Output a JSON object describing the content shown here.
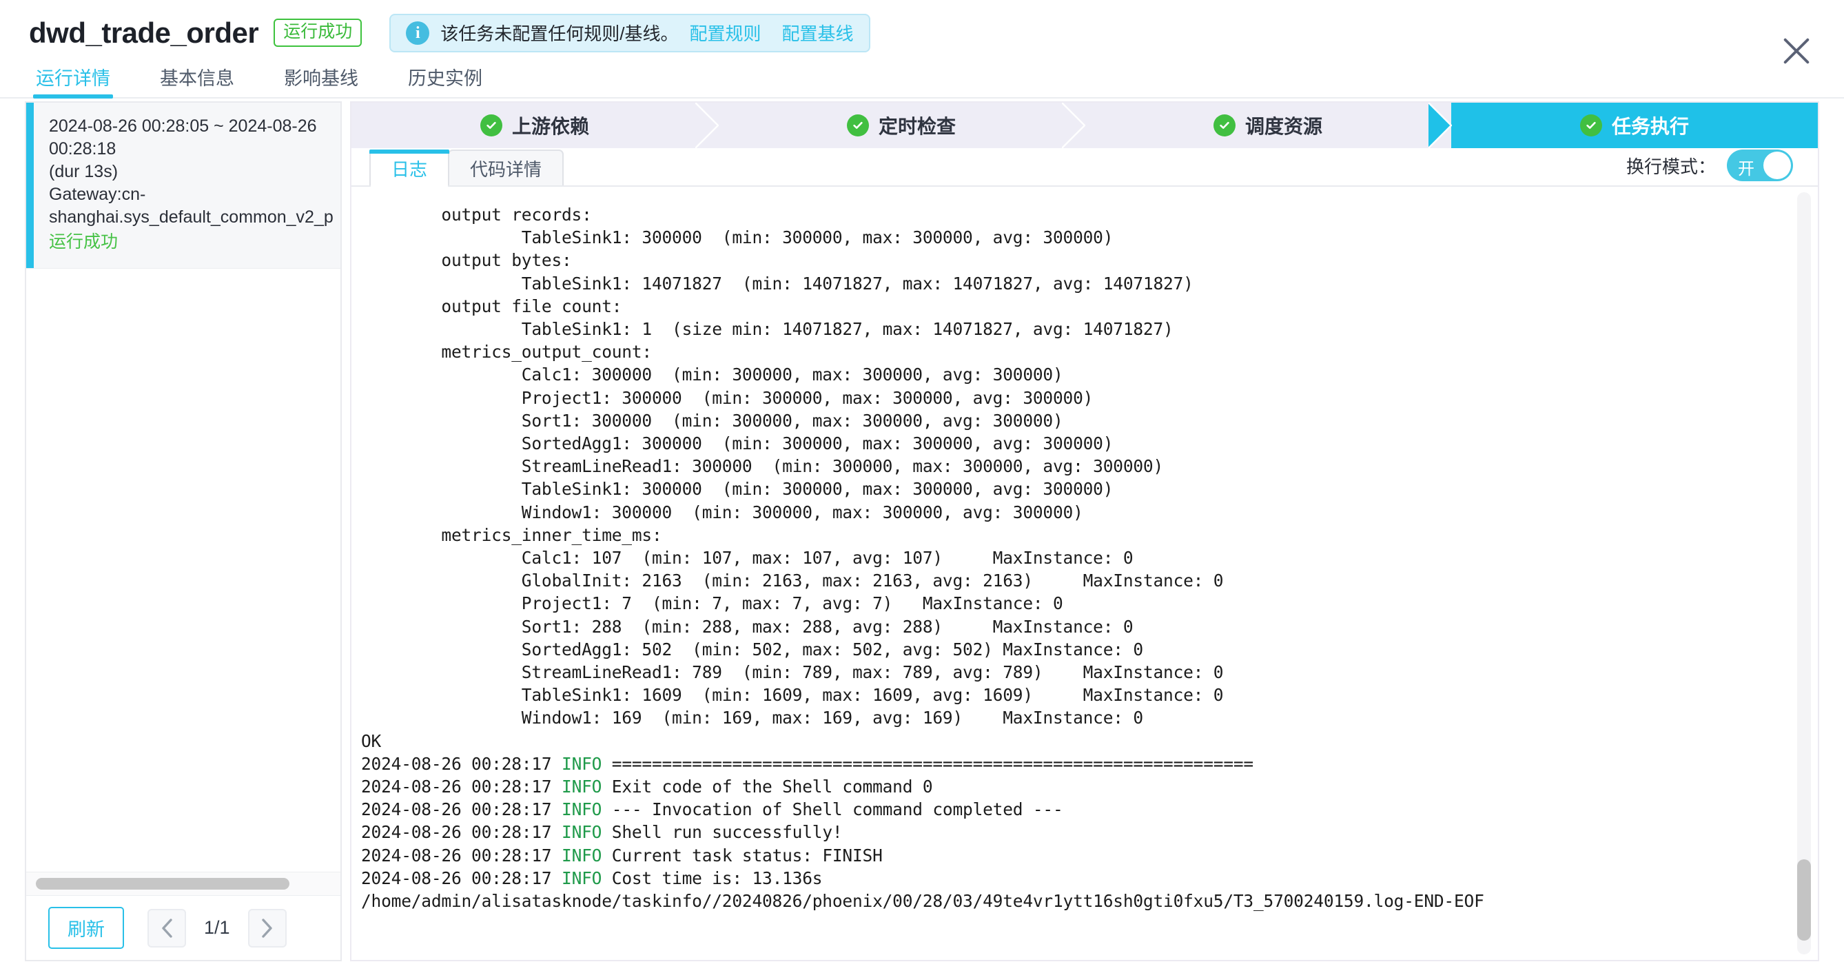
{
  "header": {
    "title": "dwd_trade_order",
    "status_badge": "运行成功",
    "notice": {
      "icon": "info-icon",
      "text": "该任务未配置任何规则/基线。",
      "links": [
        "配置规则",
        "配置基线"
      ]
    },
    "close_icon": "close-icon"
  },
  "tabs": [
    {
      "label": "运行详情",
      "active": true
    },
    {
      "label": "基本信息",
      "active": false
    },
    {
      "label": "影响基线",
      "active": false
    },
    {
      "label": "历史实例",
      "active": false
    }
  ],
  "left_panel": {
    "instance": {
      "time_range": "2024-08-26 00:28:05 ~ 2024-08-26 00:28:18",
      "duration": "(dur 13s)",
      "gateway": "Gateway:cn-shanghai.sys_default_common_v2_p",
      "status": "运行成功"
    },
    "footer": {
      "refresh_label": "刷新",
      "prev_icon": "chevron-left-icon",
      "next_icon": "chevron-right-icon",
      "page_label": "1/1"
    }
  },
  "steps": [
    {
      "label": "上游依赖",
      "state": "done",
      "icon": "check-circle-icon"
    },
    {
      "label": "定时检查",
      "state": "done",
      "icon": "check-circle-icon"
    },
    {
      "label": "调度资源",
      "state": "done",
      "icon": "check-circle-icon"
    },
    {
      "label": "任务执行",
      "state": "current",
      "icon": "check-circle-icon"
    }
  ],
  "log_panel": {
    "tabs": [
      {
        "label": "日志",
        "active": true
      },
      {
        "label": "代码详情",
        "active": false
      }
    ],
    "wrap_mode_label": "换行模式：",
    "wrap_mode_value": "开",
    "wrap_mode_on": true,
    "log_lines": [
      "        output records:",
      "                TableSink1: 300000  (min: 300000, max: 300000, avg: 300000)",
      "        output bytes:",
      "                TableSink1: 14071827  (min: 14071827, max: 14071827, avg: 14071827)",
      "        output file count:",
      "                TableSink1: 1  (size min: 14071827, max: 14071827, avg: 14071827)",
      "        metrics_output_count:",
      "                Calc1: 300000  (min: 300000, max: 300000, avg: 300000)",
      "                Project1: 300000  (min: 300000, max: 300000, avg: 300000)",
      "                Sort1: 300000  (min: 300000, max: 300000, avg: 300000)",
      "                SortedAgg1: 300000  (min: 300000, max: 300000, avg: 300000)",
      "                StreamLineRead1: 300000  (min: 300000, max: 300000, avg: 300000)",
      "                TableSink1: 300000  (min: 300000, max: 300000, avg: 300000)",
      "                Window1: 300000  (min: 300000, max: 300000, avg: 300000)",
      "        metrics_inner_time_ms:",
      "                Calc1: 107  (min: 107, max: 107, avg: 107)     MaxInstance: 0",
      "                GlobalInit: 2163  (min: 2163, max: 2163, avg: 2163)     MaxInstance: 0",
      "                Project1: 7  (min: 7, max: 7, avg: 7)   MaxInstance: 0",
      "                Sort1: 288  (min: 288, max: 288, avg: 288)     MaxInstance: 0",
      "                SortedAgg1: 502  (min: 502, max: 502, avg: 502) MaxInstance: 0",
      "                StreamLineRead1: 789  (min: 789, max: 789, avg: 789)    MaxInstance: 0",
      "                TableSink1: 1609  (min: 1609, max: 1609, avg: 1609)     MaxInstance: 0",
      "                Window1: 169  (min: 169, max: 169, avg: 169)    MaxInstance: 0",
      "OK"
    ],
    "info_lines": [
      {
        "time": "2024-08-26 00:28:17",
        "level": "INFO",
        "message": "================================================================"
      },
      {
        "time": "2024-08-26 00:28:17",
        "level": "INFO",
        "message": "Exit code of the Shell command 0"
      },
      {
        "time": "2024-08-26 00:28:17",
        "level": "INFO",
        "message": "--- Invocation of Shell command completed ---"
      },
      {
        "time": "2024-08-26 00:28:17",
        "level": "INFO",
        "message": "Shell run successfully!"
      },
      {
        "time": "2024-08-26 00:28:17",
        "level": "INFO",
        "message": "Current task status: FINISH"
      },
      {
        "time": "2024-08-26 00:28:17",
        "level": "INFO",
        "message": "Cost time is: 13.136s"
      }
    ],
    "tail_line": "/home/admin/alisatasknode/taskinfo//20240826/phoenix/00/28/03/49te4vr1ytt16sh0gti0fxu5/T3_5700240159.log-END-EOF"
  },
  "colors": {
    "accent": "#29c0e8",
    "success": "#41bf41",
    "step_done_bg": "#eeedf6",
    "step_current_bg": "#1fc1e8",
    "info_green": "#1f9a4a"
  }
}
